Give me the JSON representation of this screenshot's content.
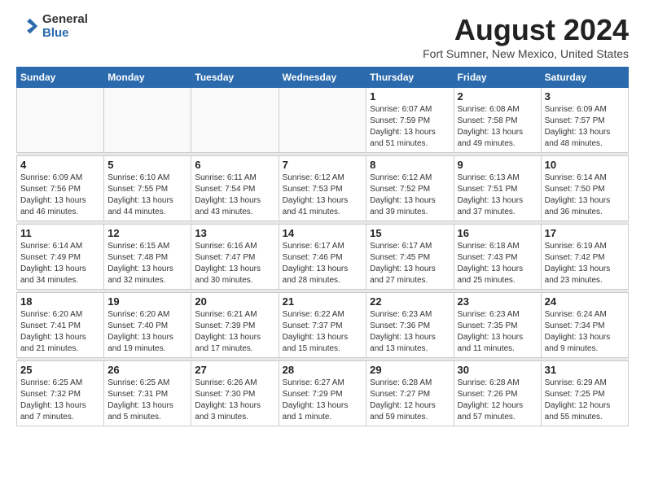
{
  "header": {
    "logo_general": "General",
    "logo_blue": "Blue",
    "month_title": "August 2024",
    "location": "Fort Sumner, New Mexico, United States"
  },
  "days_of_week": [
    "Sunday",
    "Monday",
    "Tuesday",
    "Wednesday",
    "Thursday",
    "Friday",
    "Saturday"
  ],
  "weeks": [
    {
      "days": [
        {
          "num": "",
          "info": ""
        },
        {
          "num": "",
          "info": ""
        },
        {
          "num": "",
          "info": ""
        },
        {
          "num": "",
          "info": ""
        },
        {
          "num": "1",
          "info": "Sunrise: 6:07 AM\nSunset: 7:59 PM\nDaylight: 13 hours\nand 51 minutes."
        },
        {
          "num": "2",
          "info": "Sunrise: 6:08 AM\nSunset: 7:58 PM\nDaylight: 13 hours\nand 49 minutes."
        },
        {
          "num": "3",
          "info": "Sunrise: 6:09 AM\nSunset: 7:57 PM\nDaylight: 13 hours\nand 48 minutes."
        }
      ]
    },
    {
      "days": [
        {
          "num": "4",
          "info": "Sunrise: 6:09 AM\nSunset: 7:56 PM\nDaylight: 13 hours\nand 46 minutes."
        },
        {
          "num": "5",
          "info": "Sunrise: 6:10 AM\nSunset: 7:55 PM\nDaylight: 13 hours\nand 44 minutes."
        },
        {
          "num": "6",
          "info": "Sunrise: 6:11 AM\nSunset: 7:54 PM\nDaylight: 13 hours\nand 43 minutes."
        },
        {
          "num": "7",
          "info": "Sunrise: 6:12 AM\nSunset: 7:53 PM\nDaylight: 13 hours\nand 41 minutes."
        },
        {
          "num": "8",
          "info": "Sunrise: 6:12 AM\nSunset: 7:52 PM\nDaylight: 13 hours\nand 39 minutes."
        },
        {
          "num": "9",
          "info": "Sunrise: 6:13 AM\nSunset: 7:51 PM\nDaylight: 13 hours\nand 37 minutes."
        },
        {
          "num": "10",
          "info": "Sunrise: 6:14 AM\nSunset: 7:50 PM\nDaylight: 13 hours\nand 36 minutes."
        }
      ]
    },
    {
      "days": [
        {
          "num": "11",
          "info": "Sunrise: 6:14 AM\nSunset: 7:49 PM\nDaylight: 13 hours\nand 34 minutes."
        },
        {
          "num": "12",
          "info": "Sunrise: 6:15 AM\nSunset: 7:48 PM\nDaylight: 13 hours\nand 32 minutes."
        },
        {
          "num": "13",
          "info": "Sunrise: 6:16 AM\nSunset: 7:47 PM\nDaylight: 13 hours\nand 30 minutes."
        },
        {
          "num": "14",
          "info": "Sunrise: 6:17 AM\nSunset: 7:46 PM\nDaylight: 13 hours\nand 28 minutes."
        },
        {
          "num": "15",
          "info": "Sunrise: 6:17 AM\nSunset: 7:45 PM\nDaylight: 13 hours\nand 27 minutes."
        },
        {
          "num": "16",
          "info": "Sunrise: 6:18 AM\nSunset: 7:43 PM\nDaylight: 13 hours\nand 25 minutes."
        },
        {
          "num": "17",
          "info": "Sunrise: 6:19 AM\nSunset: 7:42 PM\nDaylight: 13 hours\nand 23 minutes."
        }
      ]
    },
    {
      "days": [
        {
          "num": "18",
          "info": "Sunrise: 6:20 AM\nSunset: 7:41 PM\nDaylight: 13 hours\nand 21 minutes."
        },
        {
          "num": "19",
          "info": "Sunrise: 6:20 AM\nSunset: 7:40 PM\nDaylight: 13 hours\nand 19 minutes."
        },
        {
          "num": "20",
          "info": "Sunrise: 6:21 AM\nSunset: 7:39 PM\nDaylight: 13 hours\nand 17 minutes."
        },
        {
          "num": "21",
          "info": "Sunrise: 6:22 AM\nSunset: 7:37 PM\nDaylight: 13 hours\nand 15 minutes."
        },
        {
          "num": "22",
          "info": "Sunrise: 6:23 AM\nSunset: 7:36 PM\nDaylight: 13 hours\nand 13 minutes."
        },
        {
          "num": "23",
          "info": "Sunrise: 6:23 AM\nSunset: 7:35 PM\nDaylight: 13 hours\nand 11 minutes."
        },
        {
          "num": "24",
          "info": "Sunrise: 6:24 AM\nSunset: 7:34 PM\nDaylight: 13 hours\nand 9 minutes."
        }
      ]
    },
    {
      "days": [
        {
          "num": "25",
          "info": "Sunrise: 6:25 AM\nSunset: 7:32 PM\nDaylight: 13 hours\nand 7 minutes."
        },
        {
          "num": "26",
          "info": "Sunrise: 6:25 AM\nSunset: 7:31 PM\nDaylight: 13 hours\nand 5 minutes."
        },
        {
          "num": "27",
          "info": "Sunrise: 6:26 AM\nSunset: 7:30 PM\nDaylight: 13 hours\nand 3 minutes."
        },
        {
          "num": "28",
          "info": "Sunrise: 6:27 AM\nSunset: 7:29 PM\nDaylight: 13 hours\nand 1 minute."
        },
        {
          "num": "29",
          "info": "Sunrise: 6:28 AM\nSunset: 7:27 PM\nDaylight: 12 hours\nand 59 minutes."
        },
        {
          "num": "30",
          "info": "Sunrise: 6:28 AM\nSunset: 7:26 PM\nDaylight: 12 hours\nand 57 minutes."
        },
        {
          "num": "31",
          "info": "Sunrise: 6:29 AM\nSunset: 7:25 PM\nDaylight: 12 hours\nand 55 minutes."
        }
      ]
    }
  ]
}
